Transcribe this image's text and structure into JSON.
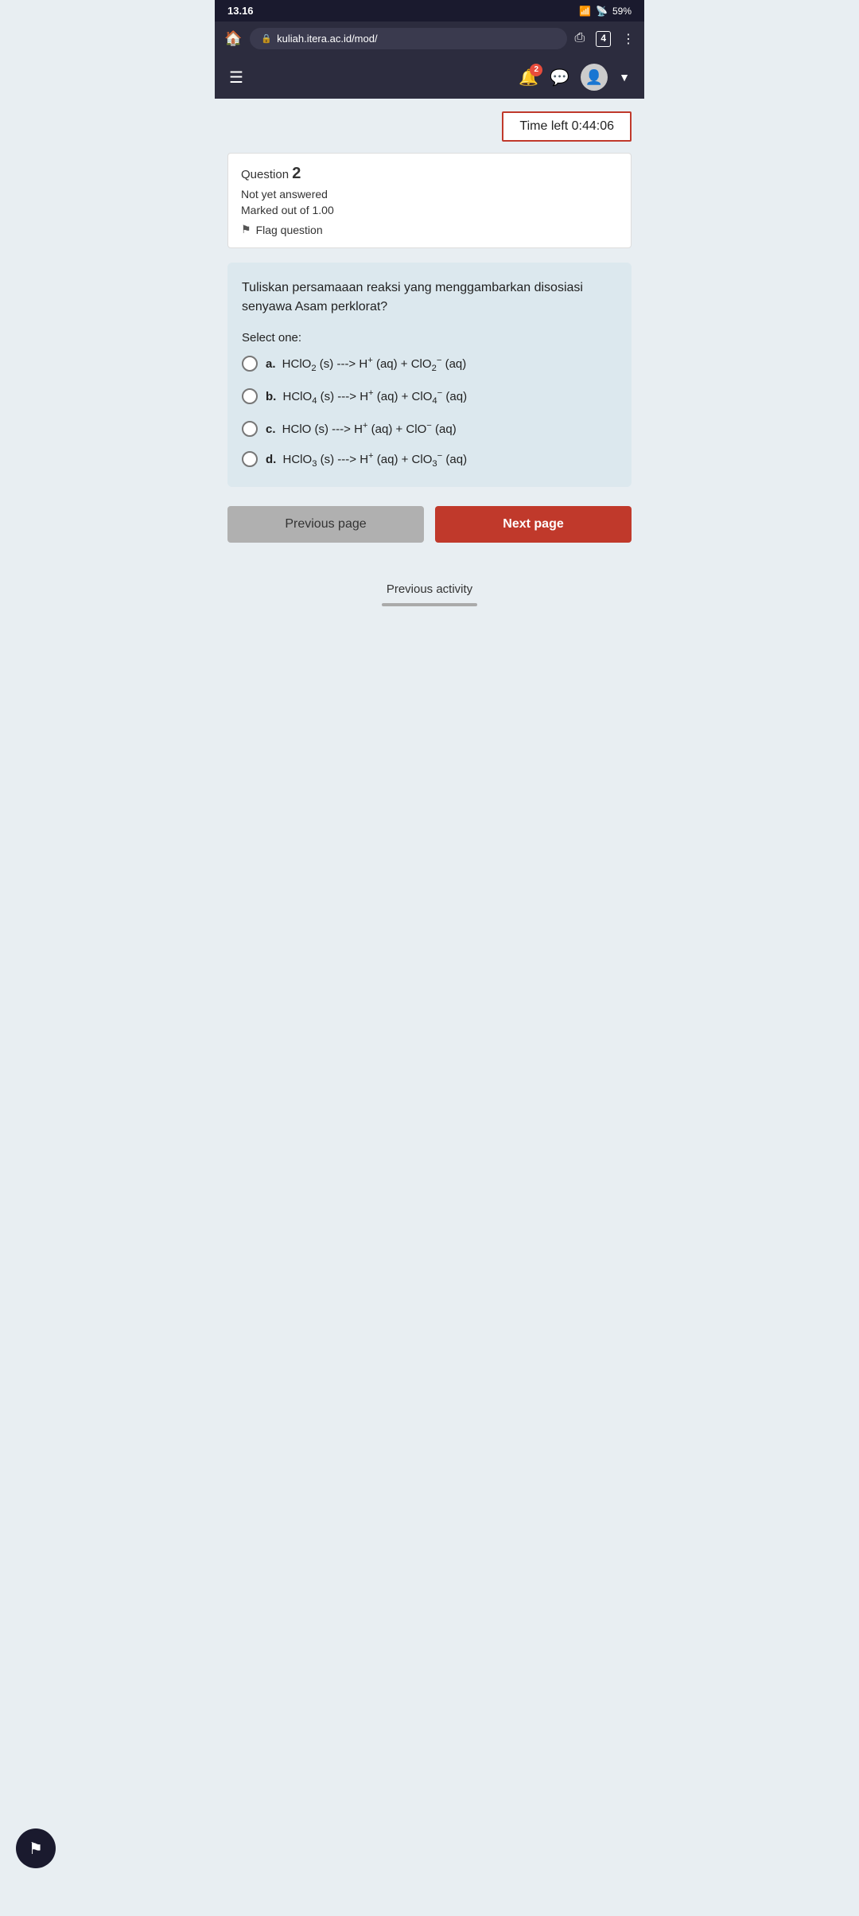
{
  "statusBar": {
    "time": "13.16",
    "battery": "59%",
    "signal": "●●●"
  },
  "browserBar": {
    "url": "kuliah.itera.ac.id/mod/",
    "tabCount": "4"
  },
  "navBar": {
    "notifCount": "2"
  },
  "timer": {
    "label": "Time left 0:44:06"
  },
  "questionInfo": {
    "questionLabel": "Question",
    "questionNumber": "2",
    "status": "Not yet answered",
    "marks": "Marked out of 1.00",
    "flagLabel": "Flag question"
  },
  "questionCard": {
    "questionText": "Tuliskan persamaaan reaksi yang menggambarkan disosiasi senyawa Asam perklorat?",
    "selectOneLabel": "Select one:",
    "options": [
      {
        "key": "a",
        "text": "HClO₂ (s) ---> H⁺ (aq) + ClO₂⁻ (aq)"
      },
      {
        "key": "b",
        "text": "HClO₄ (s) ---> H⁺ (aq) + ClO₄⁻ (aq)"
      },
      {
        "key": "c",
        "text": "HClO (s) ---> H⁺ (aq) + ClO⁻ (aq)"
      },
      {
        "key": "d",
        "text": "HClO₃ (s) ---> H⁺ (aq) + ClO₃⁻ (aq)"
      }
    ]
  },
  "buttons": {
    "prev": "Previous page",
    "next": "Next page"
  },
  "bottomBar": {
    "label": "Previous activity"
  }
}
